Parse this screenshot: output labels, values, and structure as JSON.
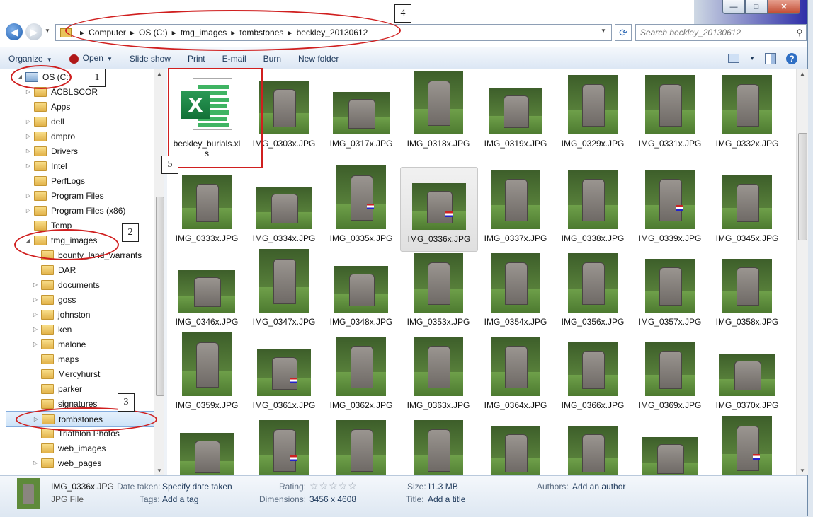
{
  "window": {
    "caption_min": "—",
    "caption_max": "□",
    "caption_close": "✕"
  },
  "address": {
    "crumbs": [
      "Computer",
      "OS (C:)",
      "tmg_images",
      "tombstones",
      "beckley_20130612"
    ],
    "search_placeholder": "Search beckley_20130612"
  },
  "toolbar": {
    "organize": "Organize",
    "open": "Open",
    "slideshow": "Slide show",
    "print": "Print",
    "email": "E-mail",
    "burn": "Burn",
    "new_folder": "New folder"
  },
  "tree": [
    {
      "label": "OS (C:)",
      "type": "drive",
      "expander": "◢",
      "indent": 0
    },
    {
      "label": "ACBLSCOR",
      "type": "folder",
      "expander": "▷",
      "indent": 1
    },
    {
      "label": "Apps",
      "type": "folder",
      "expander": "",
      "indent": 1
    },
    {
      "label": "dell",
      "type": "folder",
      "expander": "▷",
      "indent": 1
    },
    {
      "label": "dmpro",
      "type": "folder",
      "expander": "▷",
      "indent": 1
    },
    {
      "label": "Drivers",
      "type": "folder",
      "expander": "▷",
      "indent": 1
    },
    {
      "label": "Intel",
      "type": "folder",
      "expander": "▷",
      "indent": 1
    },
    {
      "label": "PerfLogs",
      "type": "folder",
      "expander": "",
      "indent": 1
    },
    {
      "label": "Program Files",
      "type": "folder",
      "expander": "▷",
      "indent": 1
    },
    {
      "label": "Program Files (x86)",
      "type": "folder",
      "expander": "▷",
      "indent": 1
    },
    {
      "label": "Temp",
      "type": "folder",
      "expander": "",
      "indent": 1
    },
    {
      "label": "tmg_images",
      "type": "folder",
      "expander": "◢",
      "indent": 1
    },
    {
      "label": "bounty_land_warrants",
      "type": "folder",
      "expander": "",
      "indent": 2
    },
    {
      "label": "DAR",
      "type": "folder",
      "expander": "",
      "indent": 2
    },
    {
      "label": "documents",
      "type": "folder",
      "expander": "▷",
      "indent": 2
    },
    {
      "label": "goss",
      "type": "folder",
      "expander": "▷",
      "indent": 2
    },
    {
      "label": "johnston",
      "type": "folder",
      "expander": "▷",
      "indent": 2
    },
    {
      "label": "ken",
      "type": "folder",
      "expander": "▷",
      "indent": 2
    },
    {
      "label": "malone",
      "type": "folder",
      "expander": "▷",
      "indent": 2
    },
    {
      "label": "maps",
      "type": "folder",
      "expander": "",
      "indent": 2
    },
    {
      "label": "Mercyhurst",
      "type": "folder",
      "expander": "",
      "indent": 2
    },
    {
      "label": "parker",
      "type": "folder",
      "expander": "",
      "indent": 2
    },
    {
      "label": "signatures",
      "type": "folder",
      "expander": "",
      "indent": 2
    },
    {
      "label": "tombstones",
      "type": "folder",
      "expander": "▷",
      "indent": 2,
      "selected": true
    },
    {
      "label": "Triathlon Photos",
      "type": "folder",
      "expander": "",
      "indent": 2
    },
    {
      "label": "web_images",
      "type": "folder",
      "expander": "",
      "indent": 2
    },
    {
      "label": "web_pages",
      "type": "folder",
      "expander": "▷",
      "indent": 2
    }
  ],
  "files": [
    {
      "name": "beckley_burials.xls",
      "kind": "xls"
    },
    {
      "name": "IMG_0303x.JPG"
    },
    {
      "name": "IMG_0317x.JPG"
    },
    {
      "name": "IMG_0318x.JPG"
    },
    {
      "name": "IMG_0319x.JPG"
    },
    {
      "name": "IMG_0329x.JPG"
    },
    {
      "name": "IMG_0331x.JPG"
    },
    {
      "name": "IMG_0332x.JPG"
    },
    {
      "name": "IMG_0333x.JPG"
    },
    {
      "name": "IMG_0334x.JPG"
    },
    {
      "name": "IMG_0335x.JPG",
      "flag": true
    },
    {
      "name": "IMG_0336x.JPG",
      "flag": true,
      "selected": true
    },
    {
      "name": "IMG_0337x.JPG"
    },
    {
      "name": "IMG_0338x.JPG"
    },
    {
      "name": "IMG_0339x.JPG",
      "flag": true
    },
    {
      "name": "IMG_0345x.JPG"
    },
    {
      "name": "IMG_0346x.JPG"
    },
    {
      "name": "IMG_0347x.JPG"
    },
    {
      "name": "IMG_0348x.JPG"
    },
    {
      "name": "IMG_0353x.JPG"
    },
    {
      "name": "IMG_0354x.JPG"
    },
    {
      "name": "IMG_0356x.JPG"
    },
    {
      "name": "IMG_0357x.JPG"
    },
    {
      "name": "IMG_0358x.JPG"
    },
    {
      "name": "IMG_0359x.JPG"
    },
    {
      "name": "IMG_0361x.JPG",
      "flag": true
    },
    {
      "name": "IMG_0362x.JPG"
    },
    {
      "name": "IMG_0363x.JPG"
    },
    {
      "name": "IMG_0364x.JPG"
    },
    {
      "name": "IMG_0366x.JPG"
    },
    {
      "name": "IMG_0369x.JPG"
    },
    {
      "name": "IMG_0370x.JPG"
    },
    {
      "name": ""
    },
    {
      "name": "",
      "flag": true
    },
    {
      "name": ""
    },
    {
      "name": ""
    },
    {
      "name": ""
    },
    {
      "name": ""
    },
    {
      "name": ""
    },
    {
      "name": "",
      "flag": true
    }
  ],
  "annotations": [
    "1",
    "2",
    "3",
    "4",
    "5"
  ],
  "details": {
    "name": "IMG_0336x.JPG",
    "type": "JPG File",
    "date_taken_label": "Date taken:",
    "date_taken_value": "Specify date taken",
    "tags_label": "Tags:",
    "tags_value": "Add a tag",
    "rating_label": "Rating:",
    "rating_stars": "☆☆☆☆☆",
    "dimensions_label": "Dimensions:",
    "dimensions_value": "3456 x 4608",
    "size_label": "Size:",
    "size_value": "11.3 MB",
    "title_label": "Title:",
    "title_value": "Add a title",
    "authors_label": "Authors:",
    "authors_value": "Add an author"
  }
}
